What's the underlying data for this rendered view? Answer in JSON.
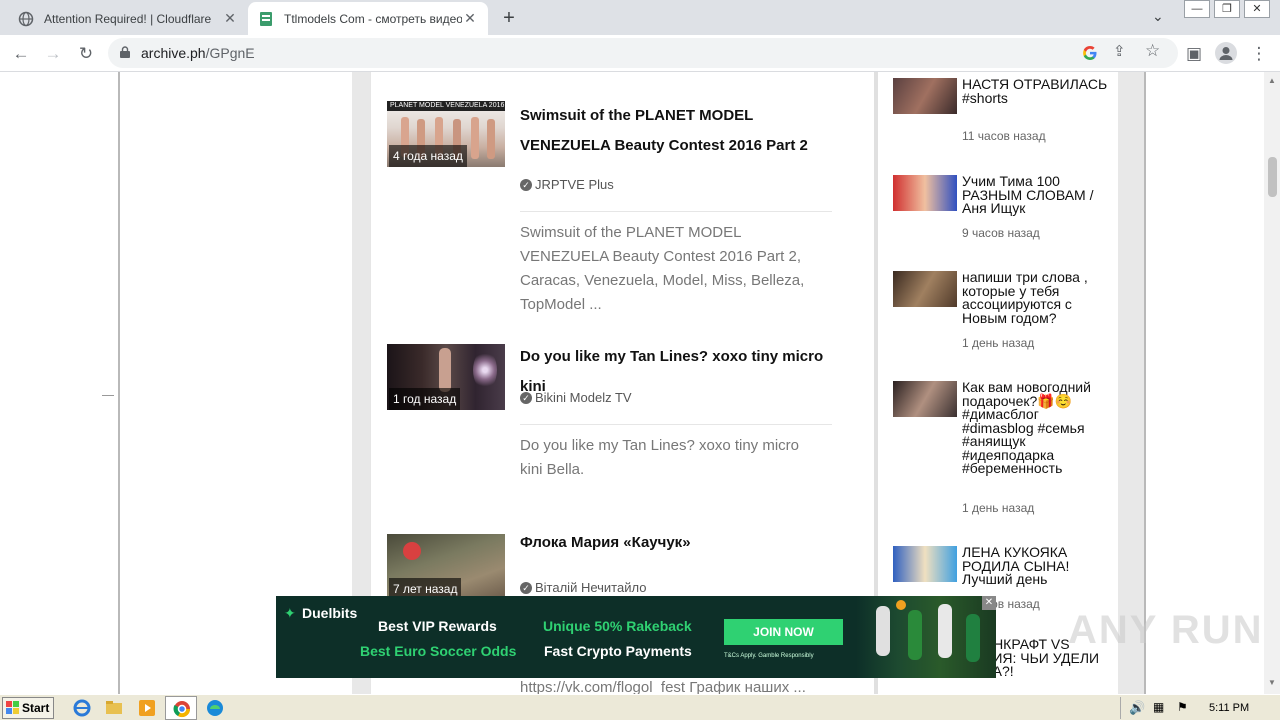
{
  "browser": {
    "tabs": [
      {
        "title": "Attention Required! | Cloudflare",
        "active": false
      },
      {
        "title": "Ttlmodels Com - смотреть видео он",
        "active": true
      }
    ],
    "url_host": "archive.ph",
    "url_path": "/GPgnE"
  },
  "videos": [
    {
      "age": "4 года назад",
      "thumb_caption": "PLANET MODEL VENEZUELA 2016",
      "title": "Swimsuit of the PLANET MODEL VENEZUELA Beauty Contest 2016 Part 2",
      "channel": "JRPTVE Plus",
      "description": "Swimsuit of the PLANET MODEL VENEZUELA Beauty Contest 2016 Part 2, Caracas, Venezuela, Model, Miss, Belleza, TopModel ..."
    },
    {
      "age": "1 год назад",
      "title": "Do you like my Tan Lines? xoxo tiny micro kini",
      "channel": "Bikini Modelz TV",
      "description": "Do you like my Tan Lines? xoxo tiny micro kini Bella."
    },
    {
      "age": "7 лет назад",
      "title": "Флока Мария «Каучук»",
      "channel": "Віталій Нечитайло",
      "description": "https://vk.com/flogol_fest График наших ..."
    }
  ],
  "sidebar": [
    {
      "title": "НАСТЯ ОТРАВИЛАСЬ #shorts",
      "time": "11 часов назад"
    },
    {
      "title": "Учим Тима 100 РАЗНЫМ СЛОВАМ / Аня Ищук",
      "time": "9 часов назад"
    },
    {
      "title": "напиши три слова , которые у тебя ассоциируются с Новым годом?",
      "time": "1 день назад"
    },
    {
      "title": "Как вам новогодний подарочек?🎁☺️ #димасблог #dimasblog #семья #аняищук #идеяподарка #беременность",
      "time": "1 день назад"
    },
    {
      "title": "ЛЕНА КУКОЯКА РОДИЛА СЫНА! Лучший день",
      "time": "5 часов назад"
    },
    {
      "title": "МАЙНКРАФТ VS МАРИЯ: ЧЬИ УДЕЛИ ИМБА?!",
      "time": ""
    }
  ],
  "ad": {
    "brand": "Duelbits",
    "line1_left": "Best VIP Rewards",
    "line1_right": "Unique 50% Rakeback",
    "line2_left": "Best Euro Soccer Odds",
    "line2_right": "Fast Crypto Payments",
    "cta": "JOIN NOW",
    "legal": "T&Cs Apply.  Gamble Responsibly"
  },
  "watermark": "ANY RUN",
  "taskbar": {
    "start_label": "Start",
    "clock": "5:11 PM"
  },
  "colors": {
    "ad_bg": "#0d2f28",
    "ad_accent": "#2fd172"
  }
}
